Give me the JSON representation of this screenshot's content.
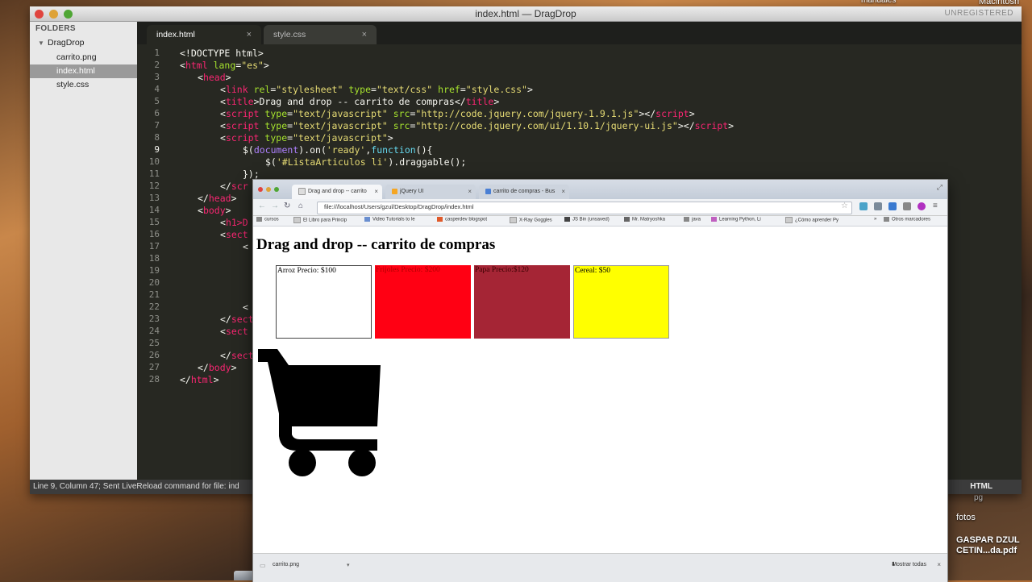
{
  "desktop": {
    "hd_label": "Macintosh HD",
    "manuales_label": "manuales",
    "fotos_label": "fotos",
    "pg_label": "pg",
    "pdf_label_line1": "GASPAR DZUL",
    "pdf_label_line2": "CETIN...da.pdf"
  },
  "sublime": {
    "window_title": "index.html — DragDrop",
    "unregistered": "UNREGISTERED",
    "sidebar": {
      "header": "FOLDERS",
      "folder": "DragDrop",
      "files": [
        "carrito.png",
        "index.html",
        "style.css"
      ]
    },
    "tabs": [
      {
        "label": "index.html",
        "active": true
      },
      {
        "label": "style.css",
        "active": false
      }
    ],
    "close_glyph": "×",
    "line_numbers": [
      "1",
      "2",
      "3",
      "4",
      "5",
      "6",
      "7",
      "8",
      "9",
      "10",
      "11",
      "12",
      "13",
      "14",
      "15",
      "16",
      "17",
      "18",
      "19",
      "20",
      "21",
      "22",
      "23",
      "24",
      "25",
      "26",
      "27",
      "28"
    ],
    "code": {
      "l1": "<!DOCTYPE html>",
      "l2_tag": "html",
      "l2_attr": "lang",
      "l2_val": "\"es\"",
      "l3": "head",
      "l4_attr1": "rel",
      "l4_val1": "\"stylesheet\"",
      "l4_attr2": "type",
      "l4_val2": "\"text/css\"",
      "l4_attr3": "href",
      "l4_val3": "\"style.css\"",
      "l5_text": "Drag and drop -- carrito de compras",
      "l6_src": "\"http://code.jquery.com/jquery-1.9.1.js\"",
      "l7_src": "\"http://code.jquery.com/ui/1.10.1/jquery-ui.js\"",
      "type_val": "\"text/javascript\"",
      "l9_a": "$(",
      "l9_doc": "document",
      "l9_b": ").on(",
      "l9_ready": "'ready'",
      "l9_c": ",",
      "l9_fn": "function",
      "l9_d": "(){",
      "l10_a": "$(",
      "l10_sel": "'#ListaArticulos li'",
      "l10_b": ").draggable();",
      "l11": "});",
      "l12_frag": "scr",
      "l13": "head",
      "l14": "body",
      "l15_frag": "h1>D",
      "l16_frag": "sect",
      "l17_frag": "<",
      "l22_frag": "<",
      "l23_frag": "sect",
      "l24_frag": "sect",
      "l26_frag": "sect",
      "l27": "body",
      "l28": "html"
    },
    "status_text": "Line 9, Column 47; Sent LiveReload command for file: ind",
    "syntax_label": "HTML"
  },
  "browser": {
    "tabs": [
      {
        "label": "Drag and drop -- carrito",
        "color": "#e8e8e8"
      },
      {
        "label": "jQuery UI",
        "color": "#f5a623"
      },
      {
        "label": "carrito de compras - Bus",
        "color": "#4a7fd4"
      }
    ],
    "url": "file:///localhost/Users/gzul/Desktop/DragDrop/index.html",
    "bookmarks": [
      "cursos",
      "El Libro para Princip",
      "Video Tutorials to le",
      "casperdev blogspot",
      "X-Ray Goggles",
      "JS Bin (unsaved)",
      "Mr. Matryoshka",
      "java",
      "Learning Python, Li",
      "¿Cómo aprender Py",
      "»",
      "Otros marcadores"
    ],
    "page_title": "Drag and drop -- carrito de compras",
    "items": [
      {
        "label": "Arroz Precio: $100",
        "bg": "#ffffff",
        "fg": "#000000"
      },
      {
        "label": "Frijoles Precio: $200",
        "bg": "#ff0013",
        "fg": "#b00000"
      },
      {
        "label": "Papa Precio:$120",
        "bg": "#a52535",
        "fg": "#3a0000"
      },
      {
        "label": "Cereal: $50",
        "bg": "#ffff00",
        "fg": "#000000"
      }
    ],
    "download_file": "carrito.png",
    "show_all": "Mostrar todas"
  }
}
